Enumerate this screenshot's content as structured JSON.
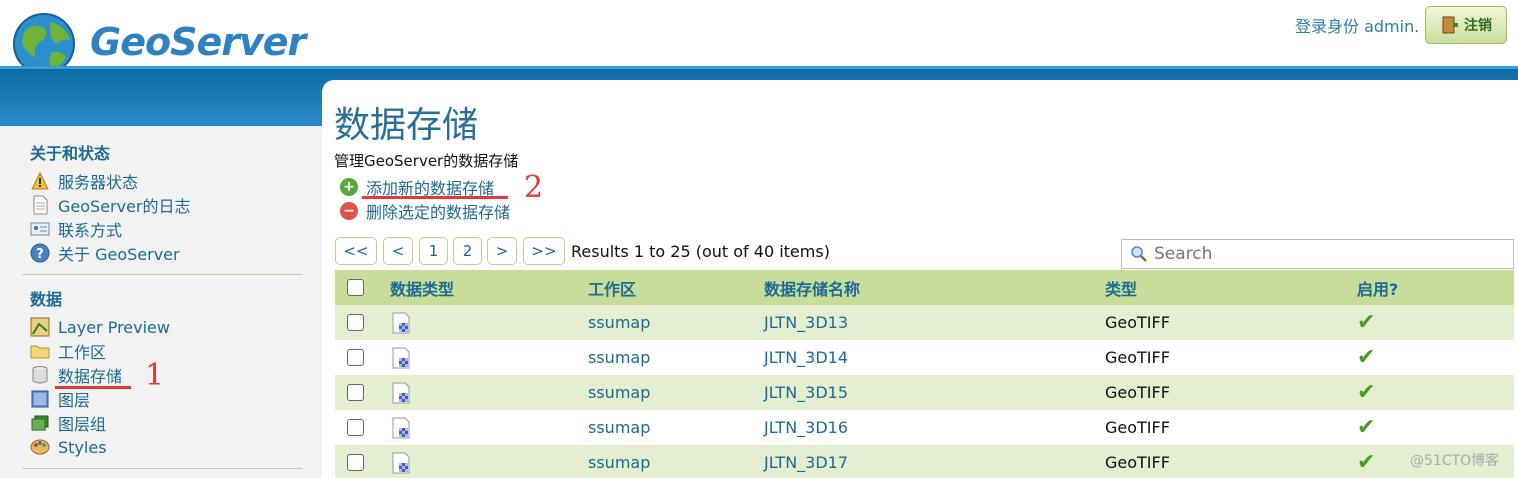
{
  "header": {
    "logo_text": "GeoServer",
    "login_text": "登录身份 admin.",
    "logout_label": "注销"
  },
  "sidebar": {
    "sections": [
      {
        "title": "关于和状态",
        "items": [
          {
            "label": "服务器状态",
            "icon": "server-status-icon"
          },
          {
            "label": "GeoServer的日志",
            "icon": "document-icon"
          },
          {
            "label": "联系方式",
            "icon": "contact-card-icon"
          },
          {
            "label": "关于 GeoServer",
            "icon": "help-icon"
          }
        ]
      },
      {
        "title": "数据",
        "items": [
          {
            "label": "Layer Preview",
            "icon": "map-preview-icon"
          },
          {
            "label": "工作区",
            "icon": "folder-icon"
          },
          {
            "label": "数据存储",
            "icon": "database-icon"
          },
          {
            "label": "图层",
            "icon": "layer-icon"
          },
          {
            "label": "图层组",
            "icon": "layer-group-icon"
          },
          {
            "label": "Styles",
            "icon": "palette-icon"
          }
        ]
      }
    ]
  },
  "main": {
    "title": "数据存储",
    "description": "管理GeoServer的数据存储",
    "add_label": "添加新的数据存储",
    "remove_label": "删除选定的数据存储",
    "pager": {
      "first": "<<",
      "prev": "<",
      "pages": [
        "1",
        "2"
      ],
      "next": ">",
      "last": ">>",
      "results_text": "Results 1 to 25 (out of 40 items)"
    },
    "search_placeholder": "Search",
    "table": {
      "headers": [
        "数据类型",
        "工作区",
        "数据存储名称",
        "类型",
        "启用?"
      ],
      "rows": [
        {
          "workspace": "ssumap",
          "name": "JLTN_3D13",
          "type": "GeoTIFF",
          "enabled": "✔"
        },
        {
          "workspace": "ssumap",
          "name": "JLTN_3D14",
          "type": "GeoTIFF",
          "enabled": "✔"
        },
        {
          "workspace": "ssumap",
          "name": "JLTN_3D15",
          "type": "GeoTIFF",
          "enabled": "✔"
        },
        {
          "workspace": "ssumap",
          "name": "JLTN_3D16",
          "type": "GeoTIFF",
          "enabled": "✔"
        },
        {
          "workspace": "ssumap",
          "name": "JLTN_3D17",
          "type": "GeoTIFF",
          "enabled": "✔"
        }
      ]
    }
  },
  "annotations": {
    "marker_1": "1",
    "marker_2": "2"
  },
  "watermark": "@51CTO博客",
  "colors": {
    "accent_blue": "#1d6a94",
    "band_blue": "#0c6aa4",
    "row_green": "#e3efd0",
    "header_green": "#c7dd99",
    "annotation_red": "#e23a3a"
  }
}
